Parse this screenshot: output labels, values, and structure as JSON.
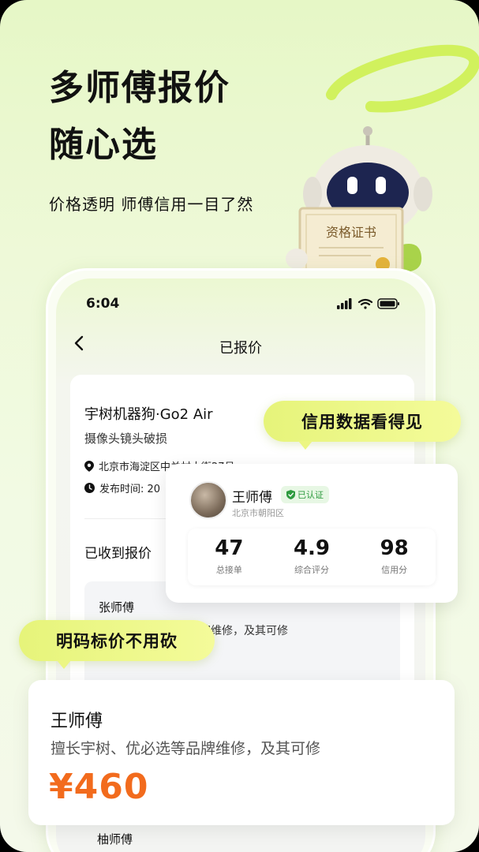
{
  "headline": {
    "line1": "多师傅报价",
    "line2": "随心选",
    "subtitle": "价格透明 师傅信用一目了然"
  },
  "robot": {
    "certificate_label": "资格证书"
  },
  "phone": {
    "status_time": "6:04",
    "nav_title": "已报价",
    "order": {
      "title": "宇树机器狗·Go2 Air",
      "description": "摄像头镜头破损",
      "address": "北京市海淀区中关村大街27号",
      "publish_time": "发布时间: 20"
    },
    "received_label": "已收到报价",
    "quotes": [
      {
        "name": "张师傅",
        "desc": "品牌维修，及其可修"
      },
      {
        "name": "柚师傅"
      }
    ]
  },
  "bubbles": {
    "credit": "信用数据看得见",
    "price": "明码标价不用砍"
  },
  "master_card": {
    "name": "王师傅",
    "badge": "已认证",
    "location": "北京市朝阳区",
    "stats": [
      {
        "value": "47",
        "label": "总接单"
      },
      {
        "value": "4.9",
        "label": "综合评分"
      },
      {
        "value": "98",
        "label": "信用分"
      }
    ]
  },
  "price_card": {
    "name": "王师傅",
    "desc": "擅长宇树、优必选等品牌维修，及其可修",
    "price": "¥460"
  },
  "colors": {
    "accent_green": "#c6ec3a",
    "price_orange": "#f26b1d",
    "bubble_yellow": "#ecf683",
    "verified_green": "#2e9b3f"
  }
}
